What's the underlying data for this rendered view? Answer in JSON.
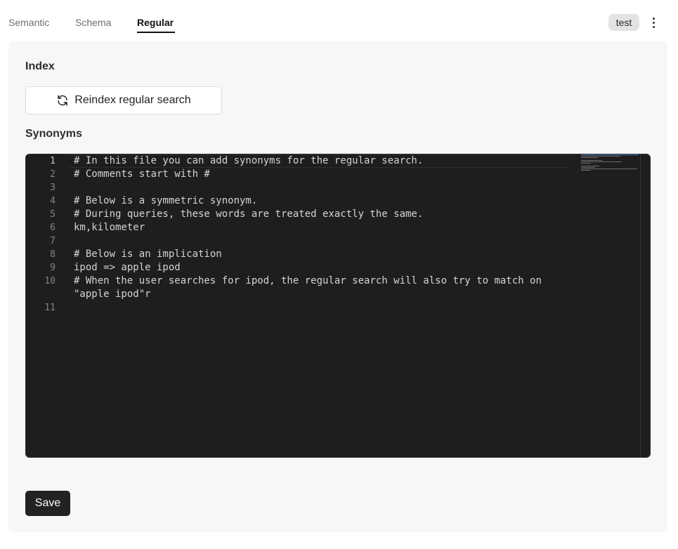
{
  "tabs": [
    {
      "label": "Semantic",
      "active": false
    },
    {
      "label": "Schema",
      "active": false
    },
    {
      "label": "Regular",
      "active": true
    }
  ],
  "header": {
    "badge": "test",
    "menu_icon": "kebab-vertical-icon"
  },
  "index": {
    "title": "Index",
    "reindex_label": "Reindex regular search",
    "reindex_icon": "refresh-icon"
  },
  "synonyms": {
    "title": "Synonyms",
    "line_numbers": [
      "1",
      "2",
      "3",
      "4",
      "5",
      "6",
      "7",
      "8",
      "9",
      "10",
      "11"
    ],
    "lines": [
      "# In this file you can add synonyms for the regular search.",
      "# Comments start with #",
      "",
      "# Below is a symmetric synonym.",
      "# During queries, these words are treated exactly the same.",
      "km,kilometer",
      "",
      "# Below is an implication",
      "ipod => apple ipod",
      "# When the user searches for ipod, the regular search will also try to match on",
      "\"apple ipod\"r",
      ""
    ]
  },
  "footer": {
    "save_label": "Save"
  },
  "colors": {
    "editor_bg": "#1e1e1e",
    "primary_button": "#222222",
    "panel_bg": "#f7f7f7"
  }
}
